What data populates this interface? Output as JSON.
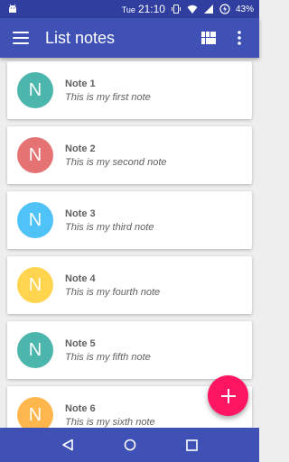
{
  "colors": {
    "status_bar": "#303f9f",
    "app_bar": "#3f51b5",
    "nav_bar": "#3f51b5",
    "fab": "#ff1561",
    "background": "#eeeeee"
  },
  "status": {
    "day": "Tue",
    "time": "21:10",
    "battery": "43%",
    "icons": [
      "android-icon",
      "vibrate-icon",
      "wifi-icon",
      "signal-icon",
      "battery-icon"
    ]
  },
  "app_bar": {
    "title": "List notes",
    "icons": [
      "menu-icon",
      "view-module-icon",
      "more-vert-icon"
    ]
  },
  "notes": [
    {
      "avatar": "N",
      "color": "#4db6ac",
      "title": "Note 1",
      "body": "This is my first note"
    },
    {
      "avatar": "N",
      "color": "#e57373",
      "title": "Note 2",
      "body": "This is my second note"
    },
    {
      "avatar": "N",
      "color": "#4fc3f7",
      "title": "Note 3",
      "body": "This is my third note"
    },
    {
      "avatar": "N",
      "color": "#ffd54f",
      "title": "Note 4",
      "body": "This is my fourth note"
    },
    {
      "avatar": "N",
      "color": "#4db6ac",
      "title": "Note 5",
      "body": "This is my fifth note"
    },
    {
      "avatar": "N",
      "color": "#ffb74d",
      "title": "Note 6",
      "body": "This is my sixth note"
    }
  ],
  "fab": {
    "icon": "add-icon"
  },
  "nav": {
    "icons": [
      "back-icon",
      "home-icon",
      "recents-icon"
    ]
  }
}
